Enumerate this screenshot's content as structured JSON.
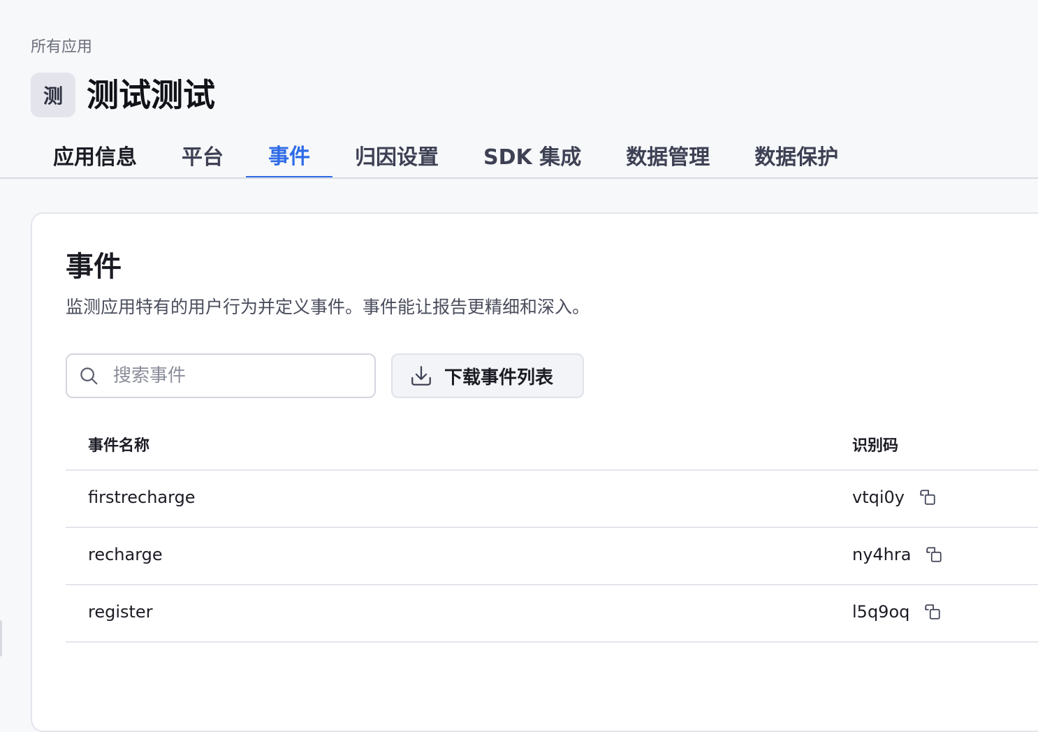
{
  "breadcrumb": "所有应用",
  "app": {
    "avatar_text": "测",
    "title": "测试测试"
  },
  "tabs": [
    {
      "label": "应用信息"
    },
    {
      "label": "平台"
    },
    {
      "label": "事件"
    },
    {
      "label": "归因设置"
    },
    {
      "label": "SDK 集成"
    },
    {
      "label": "数据管理"
    },
    {
      "label": "数据保护"
    }
  ],
  "active_tab": "事件",
  "events_section": {
    "title": "事件",
    "description": "监测应用特有的用户行为并定义事件。事件能让报告更精细和深入。",
    "search_placeholder": "搜索事件",
    "download_label": "下载事件列表"
  },
  "table": {
    "headers": {
      "name": "事件名称",
      "code": "识别码"
    },
    "rows": [
      {
        "name": "firstrecharge",
        "code": "vtqi0y"
      },
      {
        "name": "recharge",
        "code": "ny4hra"
      },
      {
        "name": "register",
        "code": "l5q9oq"
      }
    ]
  },
  "icons": {
    "search": "search-icon",
    "download": "download-icon",
    "copy": "copy-icon"
  },
  "colors": {
    "accent": "#2e6be6",
    "background": "#f7f8fa",
    "card": "#ffffff"
  }
}
